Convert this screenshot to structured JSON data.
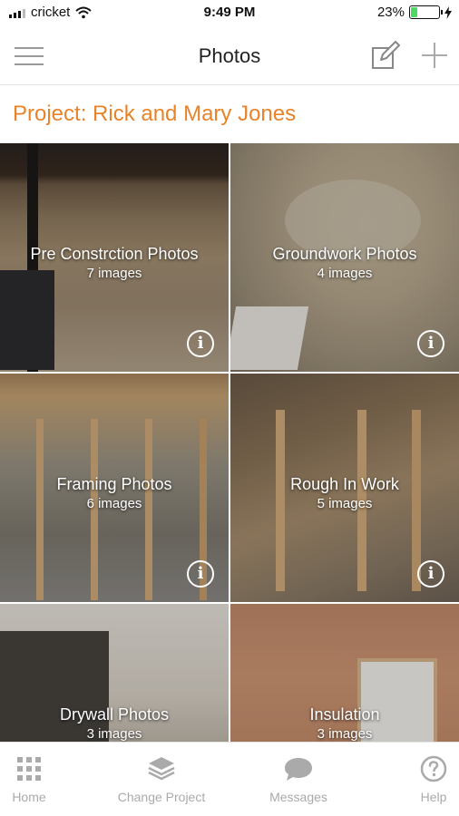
{
  "status_bar": {
    "carrier": "cricket",
    "time": "9:49 PM",
    "battery": "23%",
    "battery_level": 0.23
  },
  "header": {
    "title": "Photos"
  },
  "project": {
    "title": "Project: Rick and Mary Jones"
  },
  "albums": [
    {
      "name": "Pre Constrction Photos",
      "count": "7 images"
    },
    {
      "name": "Groundwork Photos",
      "count": "4 images"
    },
    {
      "name": "Framing Photos",
      "count": "6 images"
    },
    {
      "name": "Rough In Work",
      "count": "5 images"
    },
    {
      "name": "Drywall Photos",
      "count": "3 images"
    },
    {
      "name": "Insulation",
      "count": "3 images"
    }
  ],
  "tabs": {
    "home": "Home",
    "change_project": "Change Project",
    "messages": "Messages",
    "help": "Help"
  },
  "colors": {
    "accent": "#e8832a",
    "tab_inactive": "#aaaaaa",
    "battery": "#4cd964"
  },
  "icons": {
    "menu": "hamburger-icon",
    "edit": "edit-icon",
    "add": "plus-icon",
    "info": "info-icon",
    "home": "grid-icon",
    "change_project": "layers-icon",
    "messages": "chat-bubble-icon",
    "help": "help-icon"
  }
}
